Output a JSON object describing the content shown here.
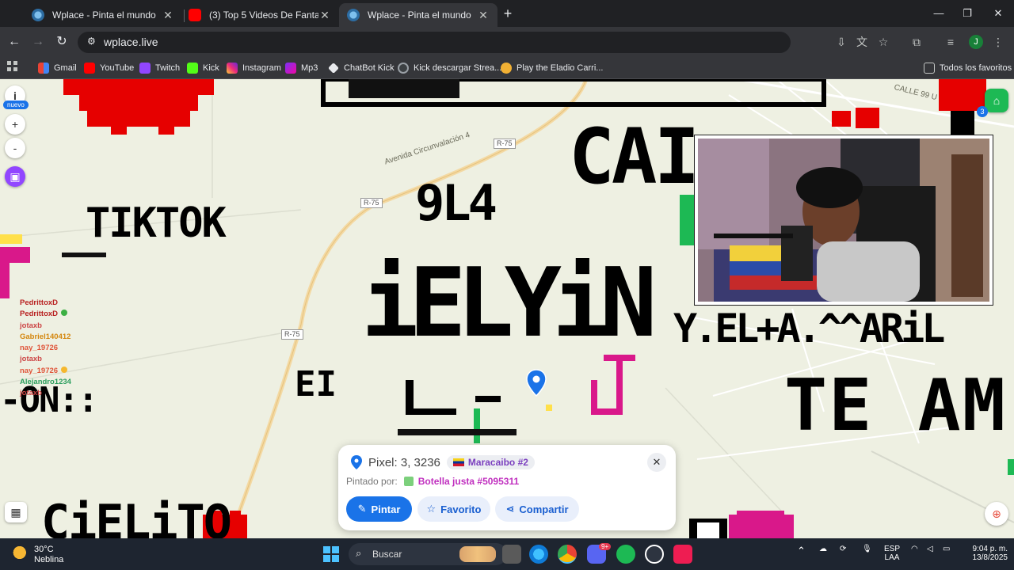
{
  "browser": {
    "tabs": [
      {
        "title": "Wplace - Pinta el mundo",
        "active": false
      },
      {
        "title": "(3) Top 5 Videos De Fantasmas",
        "active": false
      },
      {
        "title": "Wplace - Pinta el mundo",
        "active": true
      }
    ],
    "url": "wplace.live",
    "profile_initial": "J",
    "bookmarks": [
      "Gmail",
      "YouTube",
      "Twitch",
      "Kick",
      "Instagram",
      "Mp3",
      "ChatBot Kick",
      "Kick descargar Strea...",
      "Play the Eladio Carri..."
    ],
    "all_bookmarks_label": "Todos los favoritos"
  },
  "map": {
    "road_labels": [
      "R-75",
      "R-75",
      "R-75"
    ],
    "street_labels": [
      "Avenida Circunvalación 4",
      "CALLE 99 U"
    ],
    "pixel_texts": [
      "CAI",
      "9L4",
      "TIKTOK",
      "iELYiN",
      "Y.EL+A.^^ARiL",
      "TE AM",
      "EI",
      "J",
      "CiELiTO",
      "-ON::"
    ],
    "left_controls": {
      "info": "i",
      "new_badge": "nuevo",
      "zoom_in": "+",
      "zoom_out": "-"
    },
    "right_badge_count": "3"
  },
  "chat": [
    {
      "user": "PedrittoxD",
      "message": "",
      "color": "#b81f1f"
    },
    {
      "user": "PedrittoxD",
      "message": "",
      "color": "#b81f1f"
    },
    {
      "user": "jotaxb",
      "message": "",
      "color": "#c44"
    },
    {
      "user": "Gabriel140412",
      "message": "",
      "color": "#d4870f"
    },
    {
      "user": "nay_19726",
      "message": "",
      "color": "#e0553a"
    },
    {
      "user": "jotaxb",
      "message": "",
      "color": "#c44"
    },
    {
      "user": "nay_19726",
      "message": "",
      "color": "#e0553a"
    },
    {
      "user": "Alejandro1234",
      "message": "",
      "color": "#2a9d5c"
    },
    {
      "user": "jotaxb",
      "message": "",
      "color": "#c44"
    }
  ],
  "pixel_card": {
    "pixel_label": "Pixel: 3, 3236",
    "region": "Maracaibo #2",
    "painted_by_label": "Pintado por:",
    "painter": "Botella justa #5095311",
    "buttons": {
      "paint": "Pintar",
      "favorite": "Favorito",
      "share": "Compartir"
    }
  },
  "taskbar": {
    "weather_temp": "30°C",
    "weather_desc": "Neblina",
    "search_label": "Buscar",
    "lang": "ESP",
    "lang2": "LAA",
    "time": "9:04 p. m.",
    "date": "13/8/2025",
    "discord_badge": "9+"
  },
  "colors": {
    "accent": "#1a73e8",
    "map_bg": "#eef0e2",
    "pixel_red": "#e60000",
    "pixel_pink": "#d9188a",
    "pixel_green": "#1db954"
  }
}
